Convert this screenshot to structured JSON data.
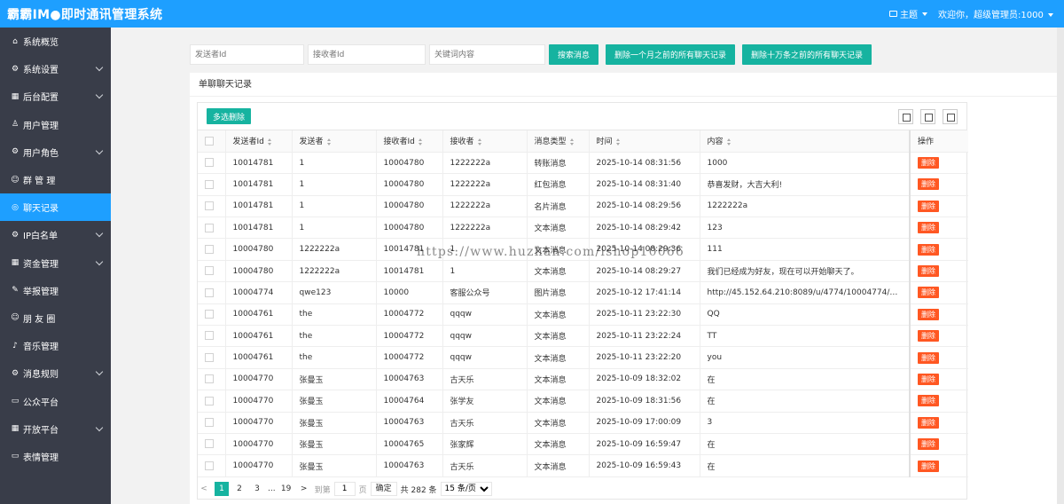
{
  "header": {
    "title": "霸霸IM●即时通讯管理系统",
    "theme_label": "主题",
    "welcome": "欢迎你，超级管理员:1000"
  },
  "sidebar": {
    "items": [
      {
        "label": "系统概览",
        "icon": "home-icon",
        "has_children": false,
        "active": false
      },
      {
        "label": "系统设置",
        "icon": "gear-icon",
        "has_children": true,
        "active": false
      },
      {
        "label": "后台配置",
        "icon": "calendar-icon",
        "has_children": true,
        "active": false
      },
      {
        "label": "用户管理",
        "icon": "user-icon",
        "has_children": false,
        "active": false
      },
      {
        "label": "用户角色",
        "icon": "gear-icon",
        "has_children": true,
        "active": false
      },
      {
        "label": "群 管 理",
        "icon": "group-icon",
        "has_children": false,
        "active": false
      },
      {
        "label": "聊天记录",
        "icon": "chat-icon",
        "has_children": false,
        "active": true
      },
      {
        "label": "IP白名单",
        "icon": "gear-icon",
        "has_children": true,
        "active": false
      },
      {
        "label": "资金管理",
        "icon": "calendar-icon",
        "has_children": true,
        "active": false
      },
      {
        "label": "举报管理",
        "icon": "report-icon",
        "has_children": false,
        "active": false
      },
      {
        "label": "朋 友 圈",
        "icon": "smile-icon",
        "has_children": false,
        "active": false
      },
      {
        "label": "音乐管理",
        "icon": "music-icon",
        "has_children": false,
        "active": false
      },
      {
        "label": "消息规则",
        "icon": "gear-icon",
        "has_children": true,
        "active": false
      },
      {
        "label": "公众平台",
        "icon": "window-icon",
        "has_children": false,
        "active": false
      },
      {
        "label": "开放平台",
        "icon": "calendar-icon",
        "has_children": true,
        "active": false
      },
      {
        "label": "表情管理",
        "icon": "window-icon",
        "has_children": false,
        "active": false
      }
    ]
  },
  "filters": {
    "sender_placeholder": "发送者Id",
    "receiver_placeholder": "接收者Id",
    "keyword_placeholder": "关键词内容",
    "search_label": "搜索消息",
    "delete_month_label": "删除一个月之前的所有聊天记录",
    "delete_100k_label": "删除十万条之前的所有聊天记录"
  },
  "card": {
    "title": "单聊聊天记录",
    "bulk_delete_label": "多选删除"
  },
  "table": {
    "columns": [
      "发送者Id",
      "发送者",
      "接收者Id",
      "接收者",
      "消息类型",
      "时间",
      "内容",
      "操作"
    ],
    "delete_label": "删除",
    "rows": [
      [
        "10014781",
        "1",
        "10004780",
        "1222222a",
        "转账消息",
        "2025-10-14 08:31:56",
        "1000"
      ],
      [
        "10014781",
        "1",
        "10004780",
        "1222222a",
        "红包消息",
        "2025-10-14 08:31:40",
        "恭喜发财，大吉大利!"
      ],
      [
        "10014781",
        "1",
        "10004780",
        "1222222a",
        "名片消息",
        "2025-10-14 08:29:56",
        "1222222a"
      ],
      [
        "10014781",
        "1",
        "10004780",
        "1222222a",
        "文本消息",
        "2025-10-14 08:29:42",
        "123"
      ],
      [
        "10004780",
        "1222222a",
        "10014781",
        "1",
        "文本消息",
        "2025-10-14 08:29:36",
        "111"
      ],
      [
        "10004780",
        "1222222a",
        "10014781",
        "1",
        "文本消息",
        "2025-10-14 08:29:27",
        "我们已经成为好友，现在可以开始聊天了。"
      ],
      [
        "10004774",
        "qwe123",
        "10000",
        "客服公众号",
        "图片消息",
        "2025-10-12 17:41:14",
        "http://45.152.64.210:8089/u/4774/10004774/202510/o..."
      ],
      [
        "10004761",
        "the",
        "10004772",
        "qqqw",
        "文本消息",
        "2025-10-11 23:22:30",
        "QQ"
      ],
      [
        "10004761",
        "the",
        "10004772",
        "qqqw",
        "文本消息",
        "2025-10-11 23:22:24",
        "TT"
      ],
      [
        "10004761",
        "the",
        "10004772",
        "qqqw",
        "文本消息",
        "2025-10-11 23:22:20",
        "you"
      ],
      [
        "10004770",
        "张曼玉",
        "10004763",
        "古天乐",
        "文本消息",
        "2025-10-09 18:32:02",
        "在"
      ],
      [
        "10004770",
        "张曼玉",
        "10004764",
        "张学友",
        "文本消息",
        "2025-10-09 18:31:56",
        "在"
      ],
      [
        "10004770",
        "张曼玉",
        "10004763",
        "古天乐",
        "文本消息",
        "2025-10-09 17:00:09",
        "3"
      ],
      [
        "10004770",
        "张曼玉",
        "10004765",
        "张家辉",
        "文本消息",
        "2025-10-09 16:59:47",
        "在"
      ],
      [
        "10004770",
        "张曼玉",
        "10004763",
        "古天乐",
        "文本消息",
        "2025-10-09 16:59:43",
        "在"
      ]
    ]
  },
  "pager": {
    "prev": "<",
    "pages": [
      "1",
      "2",
      "3"
    ],
    "ellipsis": "...",
    "last": "19",
    "next": ">",
    "goto_label": "到第",
    "goto_value": "1",
    "page_unit": "页",
    "confirm": "确定",
    "total": "共 282 条",
    "page_size": "15 条/页"
  },
  "watermark": "https://www.huzhan.com/ishop10066"
}
